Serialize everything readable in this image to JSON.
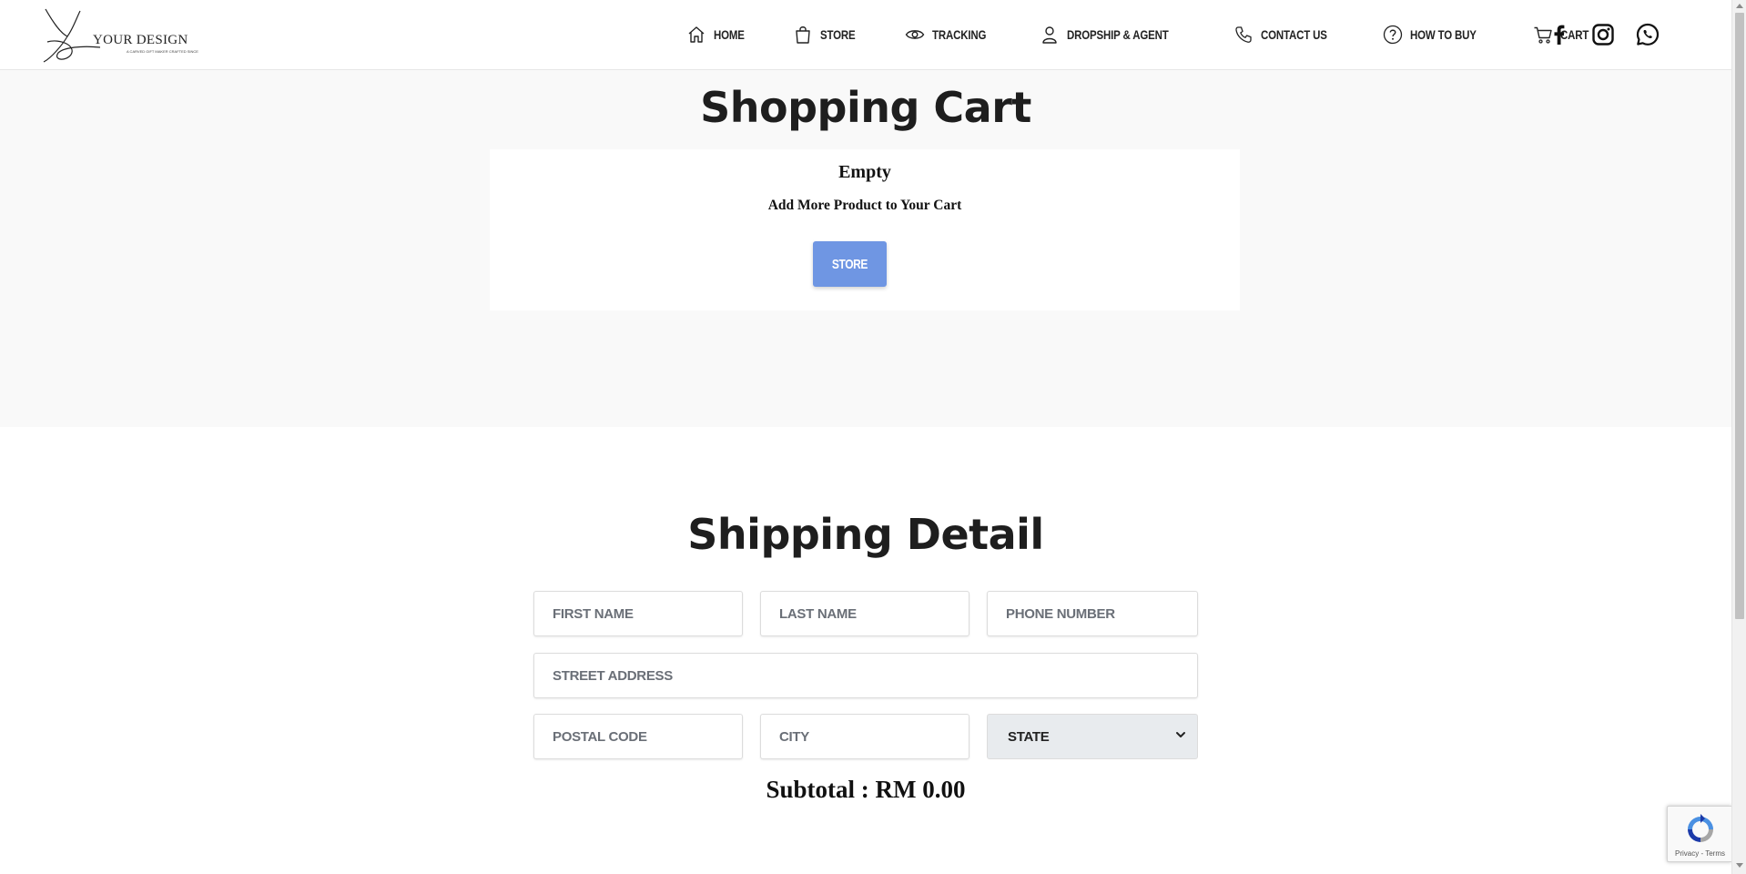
{
  "brand": {
    "name": "YOUR DESIGN",
    "tagline": "A CARVED GIFT MAKER CRAFTED SINCE"
  },
  "nav": [
    {
      "label": "HOME",
      "icon": "home-icon"
    },
    {
      "label": "STORE",
      "icon": "shopping-bag-icon"
    },
    {
      "label": "TRACKING",
      "icon": "eye-icon"
    },
    {
      "label": "DROPSHIP & AGENT",
      "icon": "user-icon"
    },
    {
      "label": "CONTACT US",
      "icon": "phone-icon"
    },
    {
      "label": "HOW TO BUY",
      "icon": "question-circle-icon"
    },
    {
      "label": "CART",
      "icon": "cart-icon"
    }
  ],
  "social": [
    "facebook-icon",
    "instagram-icon",
    "whatsapp-icon"
  ],
  "cart": {
    "title": "Shopping Cart",
    "empty_title": "Empty",
    "empty_message": "Add More Product to Your Cart",
    "store_button": "STORE"
  },
  "shipping": {
    "title": "Shipping Detail",
    "fields": {
      "first_name": "FIRST NAME",
      "last_name": "LAST NAME",
      "phone": "PHONE NUMBER",
      "street": "STREET ADDRESS",
      "postal": "POSTAL CODE",
      "city": "CITY"
    },
    "state_selected": "STATE",
    "subtotal": "Subtotal : RM 0.00"
  },
  "recaptcha": {
    "links": "Privacy - Terms"
  },
  "colors": {
    "accent": "#6f96e3",
    "section_bg": "#f9f9f9",
    "heading": "#1e1e1e"
  }
}
